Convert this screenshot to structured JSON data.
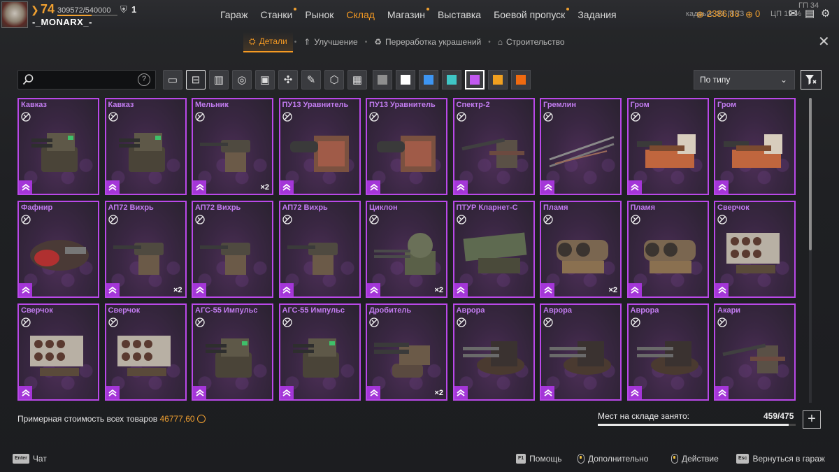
{
  "player": {
    "level": "74",
    "xp": "309572/540000",
    "xp_fraction": 0.573,
    "clan": "1",
    "nickname": "-_MONARX_-"
  },
  "nav": [
    {
      "label": "Гараж",
      "dot": false
    },
    {
      "label": "Станки",
      "dot": true
    },
    {
      "label": "Рынок",
      "dot": false
    },
    {
      "label": "Склад",
      "dot": false,
      "active": true
    },
    {
      "label": "Магазин",
      "dot": true
    },
    {
      "label": "Выставка",
      "dot": false
    },
    {
      "label": "Боевой пропуск",
      "dot": true
    },
    {
      "label": "Задания",
      "dot": false
    }
  ],
  "resources": {
    "currency_a": "2386,88",
    "currency_b": "0",
    "stats_1": "кадры/с 33",
    "stats_2": "П 73",
    "stats_3": "ЦП 19 %",
    "stats_4": "ГП 34"
  },
  "subnav": [
    {
      "label": "Детали",
      "icon": "parts-icon",
      "active": true
    },
    {
      "label": "Улучшение",
      "icon": "upgrade-icon"
    },
    {
      "label": "Переработка украшений",
      "icon": "recycle-icon"
    },
    {
      "label": "Строительство",
      "icon": "construction-icon"
    }
  ],
  "search": {
    "placeholder": "",
    "value": "",
    "help": "?"
  },
  "category_filters": [
    "cabin-icon",
    "weapon-icon",
    "module-icon",
    "wheel-icon",
    "frame-icon",
    "crafting-icon",
    "paint-icon",
    "decor-icon",
    "all-icon"
  ],
  "selected_category": 1,
  "rarity_colors": [
    "#8e8e8e",
    "#ffffff",
    "#3d95f2",
    "#3fc6c6",
    "#c158f0",
    "#f0a020",
    "#f06a10"
  ],
  "selected_rarity": 4,
  "sort": {
    "value": "По типу"
  },
  "items": [
    {
      "name": "Кавказ",
      "count": "",
      "art": "turret-a"
    },
    {
      "name": "Кавказ",
      "count": "",
      "art": "turret-a"
    },
    {
      "name": "Мельник",
      "count": "×2",
      "art": "cannon"
    },
    {
      "name": "ПУ13 Уравнитель",
      "count": "",
      "art": "gatling-box"
    },
    {
      "name": "ПУ13 Уравнитель",
      "count": "",
      "art": "gatling-box"
    },
    {
      "name": "Спектр-2",
      "count": "",
      "art": "rifle"
    },
    {
      "name": "Гремлин",
      "count": "",
      "art": "rails"
    },
    {
      "name": "Гром",
      "count": "",
      "art": "mortar"
    },
    {
      "name": "Гром",
      "count": "",
      "art": "mortar"
    },
    {
      "name": "Фафнир",
      "count": "",
      "art": "dragon"
    },
    {
      "name": "АП72 Вихрь",
      "count": "×2",
      "art": "cannon"
    },
    {
      "name": "АП72 Вихрь",
      "count": "",
      "art": "cannon"
    },
    {
      "name": "АП72 Вихрь",
      "count": "",
      "art": "cannon"
    },
    {
      "name": "Циклон",
      "count": "×2",
      "art": "dome"
    },
    {
      "name": "ПТУР Кларнет-С",
      "count": "",
      "art": "launcher"
    },
    {
      "name": "Пламя",
      "count": "×2",
      "art": "flamer"
    },
    {
      "name": "Пламя",
      "count": "",
      "art": "flamer"
    },
    {
      "name": "Сверчок",
      "count": "",
      "art": "rocket-pod"
    },
    {
      "name": "Сверчок",
      "count": "",
      "art": "rocket-pod"
    },
    {
      "name": "Сверчок",
      "count": "",
      "art": "rocket-pod"
    },
    {
      "name": "АГС-55 Импульс",
      "count": "",
      "art": "turret-a"
    },
    {
      "name": "АГС-55 Импульс",
      "count": "",
      "art": "turret-a"
    },
    {
      "name": "Дробитель",
      "count": "×2",
      "art": "shotgun"
    },
    {
      "name": "Аврора",
      "count": "",
      "art": "minigun"
    },
    {
      "name": "Аврора",
      "count": "",
      "art": "minigun"
    },
    {
      "name": "Аврора",
      "count": "",
      "art": "minigun"
    },
    {
      "name": "Акари",
      "count": "",
      "art": "rifle"
    }
  ],
  "scroll_fraction": 0.5,
  "footer": {
    "cost_label": "Примерная стоимость всех товаров",
    "cost_value": "46777,60",
    "storage_label": "Мест на складе занято:",
    "storage_value": "459/475",
    "storage_fraction": 0.966,
    "plus": "+"
  },
  "hints": [
    {
      "key": "Enter",
      "label": "Чат"
    },
    {
      "key": "F1",
      "label": "Помощь"
    },
    {
      "key": "mouse",
      "label": "Дополнительно"
    },
    {
      "key": "mouse",
      "label": "Действие"
    },
    {
      "key": "Esc",
      "label": "Вернуться в гараж"
    }
  ]
}
